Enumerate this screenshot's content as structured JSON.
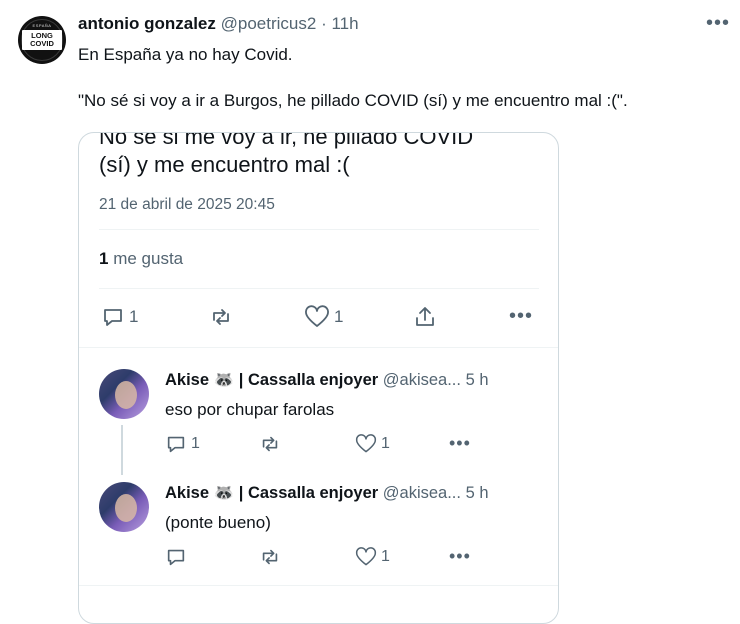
{
  "tweet": {
    "author_name": "antonio gonzalez",
    "handle": "@poetricus2",
    "separator": "·",
    "time": "11h",
    "more_label": "•••",
    "avatar_logo_text": "LONG COVID",
    "avatar_arc_text": "ESPAÑA",
    "text_line1": "En España ya no hay Covid.",
    "text_line2": "\"No sé si voy a ir a Burgos, he pillado COVID (sí) y me encuentro mal :(\"."
  },
  "quoted": {
    "cut_text_line1": "No sé si me voy a ir, he pillado COVID",
    "cut_text_line2": "(sí) y me encuentro mal :(",
    "date": "21 de abril de 2025 20:45",
    "likes_count": "1",
    "likes_label": "me gusta",
    "actions": {
      "reply_count": "1",
      "retweet_count": "",
      "like_count": "1"
    }
  },
  "replies": [
    {
      "name": "Akise 🦝 | Cassalla enjoyer",
      "handle": "@akisea...",
      "time": "5 h",
      "text": "eso por chupar farolas",
      "reply_count": "1",
      "like_count": "1"
    },
    {
      "name": "Akise 🦝 | Cassalla enjoyer",
      "handle": "@akisea...",
      "time": "5 h",
      "text": "(ponte bueno)",
      "reply_count": "",
      "like_count": "1"
    }
  ]
}
